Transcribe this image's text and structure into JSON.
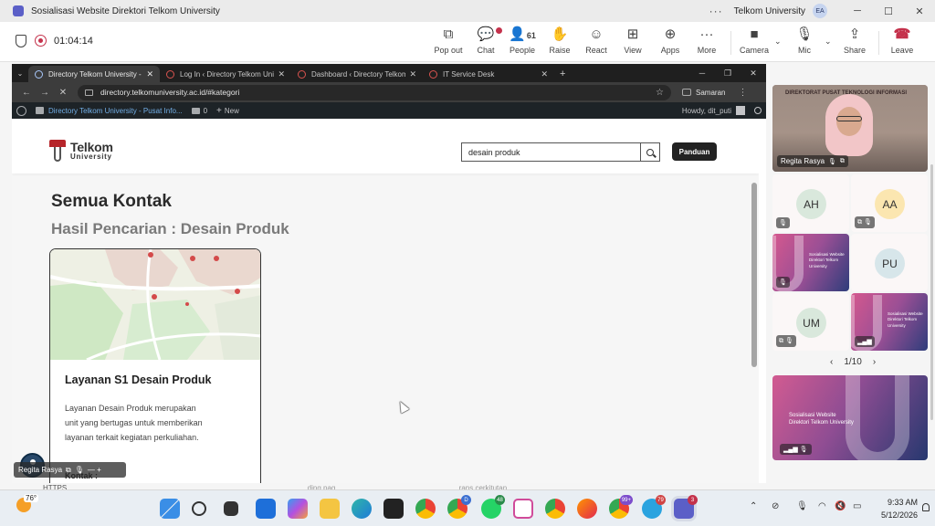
{
  "teams": {
    "window_title": "Sosialisasi Website Direktori Telkom University",
    "more_dots": "···",
    "org_name": "Telkom University",
    "user_initials": "EA",
    "timer": "01:04:14",
    "toolbar": {
      "popout": "Pop out",
      "chat": "Chat",
      "people": "People",
      "people_count": "61",
      "raise": "Raise",
      "react": "React",
      "view": "View",
      "apps": "Apps",
      "more": "More",
      "camera": "Camera",
      "mic": "Mic",
      "share": "Share",
      "leave": "Leave"
    }
  },
  "browser": {
    "tabs": [
      {
        "title": "Directory Telkom University - P"
      },
      {
        "title": "Log In ‹ Directory Telkom Univ"
      },
      {
        "title": "Dashboard ‹ Directory Telkom"
      },
      {
        "title": "IT Service Desk"
      }
    ],
    "url": "directory.telkomuniversity.ac.id/#kategori",
    "profile_name": "Samaran",
    "wp_admin": {
      "site_link": "Directory Telkom University - Pusat Info...",
      "comments_count": "0",
      "new_label": "New",
      "howdy": "Howdy, dit_puti"
    }
  },
  "site": {
    "logo_line1": "Telkom",
    "logo_line2": "University",
    "search_value": "desain produk",
    "panduan_label": "Panduan",
    "heading": "Semua Kontak",
    "subheading": "Hasil Pencarian : Desain Produk",
    "card": {
      "title": "Layanan S1 Desain Produk",
      "description": "Layanan Desain Produk merupakan unit yang bertugas untuk memberikan layanan terkait kegiatan perkuliahan.",
      "kontak_label": "Kontak :"
    },
    "bleed_text_1": "HTTPS",
    "bleed_text_2": "...ding pag...",
    "bleed_text_3": "...rans cerkitutan..."
  },
  "presenter": {
    "name": "Regita Rasya",
    "controls": "— +"
  },
  "participants": {
    "main_video_name": "Regita Rasya",
    "poster_text": "DIREKTORAT PUSAT TEKNOLOGI INFORMASI",
    "tiles": [
      {
        "initials": "AH",
        "avatar_color": "#d9e8dc"
      },
      {
        "initials": "AA",
        "avatar_color": "#fbe6b0"
      },
      {
        "initials": "",
        "type": "share"
      },
      {
        "initials": "PU",
        "avatar_color": "#d7e6ea"
      },
      {
        "initials": "UM",
        "avatar_color": "#d9e8dc"
      },
      {
        "initials": "",
        "type": "share"
      }
    ],
    "share_text_line1": "Sosialisasi Website",
    "share_text_line2": "Direktori Telkom University",
    "page_indicator": "1/10"
  },
  "taskbar": {
    "temperature": "76°",
    "chrome_badge_1": "D",
    "whatsapp_badge": "48",
    "chrome_badge_2": "99+",
    "telegram_badge": "79",
    "teams_badge": "3",
    "time": "9:33 AM",
    "date": "5/12/2026"
  }
}
